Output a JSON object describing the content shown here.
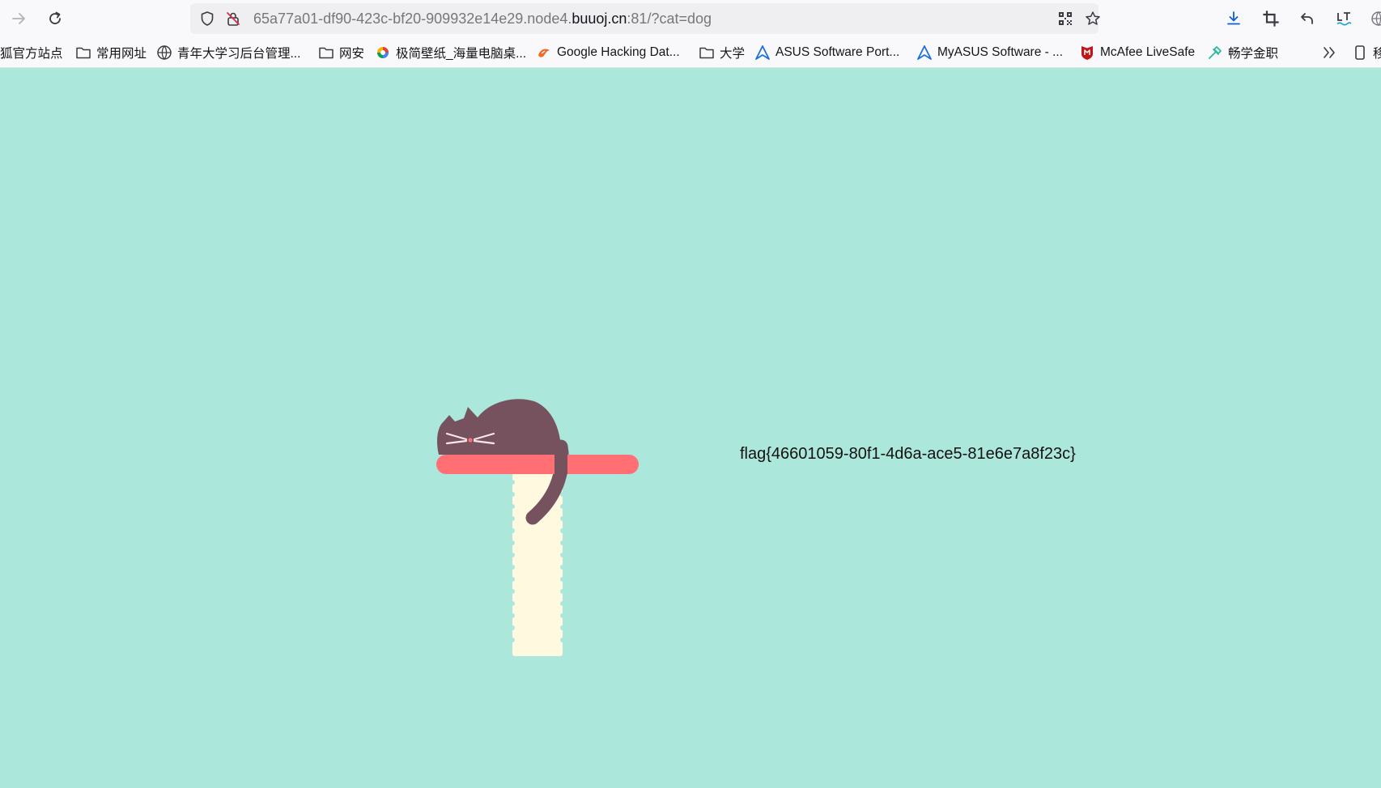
{
  "browser": {
    "url": {
      "host_prefix": "65a77a01-df90-423c-bf20-909932e14e29.node4.",
      "host_domain": "buuoj.cn",
      "rest": ":81/?cat=dog"
    },
    "toolbar_icons": [
      "back-arrow-icon",
      "reload-icon",
      "shield-icon",
      "insecure-lock-icon",
      "qr-code-icon",
      "star-icon",
      "download-icon",
      "crop-icon",
      "undo-icon",
      "translate-icon",
      "globe-icon"
    ],
    "bookmarks": [
      {
        "label": "狐官方站点",
        "icon": "none"
      },
      {
        "label": "常用网址",
        "icon": "folder-icon"
      },
      {
        "label": "青年大学习后台管理...",
        "icon": "globe-icon"
      },
      {
        "label": "网安",
        "icon": "folder-icon"
      },
      {
        "label": "极简壁纸_海量电脑桌...",
        "icon": "wallpaper-site-icon"
      },
      {
        "label": "Google Hacking Dat...",
        "icon": "exploit-db-icon"
      },
      {
        "label": "大学",
        "icon": "folder-icon"
      },
      {
        "label": "ASUS Software Port...",
        "icon": "asus-icon"
      },
      {
        "label": "MyASUS Software - ...",
        "icon": "asus-icon"
      },
      {
        "label": "McAfee LiveSafe",
        "icon": "mcafee-icon"
      },
      {
        "label": "畅学金职",
        "icon": "bookmark-site-icon"
      },
      {
        "label": "移",
        "icon": "mobile-icon"
      }
    ],
    "overflow_icon": "chevron-double-right-icon"
  },
  "page": {
    "flag": "flag{46601059-80f1-4d6a-ace5-81e6e7a8f23c}",
    "illustration": "cat-sleeping-on-scratching-post",
    "colors": {
      "background": "#ace7dc",
      "cat": "#76525f",
      "platform": "#ff6f74",
      "post": "#fff9e0"
    }
  }
}
